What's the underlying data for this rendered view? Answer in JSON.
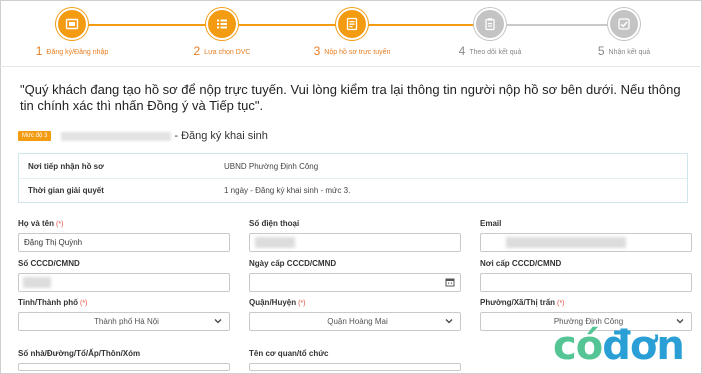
{
  "stepper": {
    "steps": [
      {
        "num": "1",
        "label": "Đăng ký/Đăng nhập",
        "icon": "login-icon",
        "active": true
      },
      {
        "num": "2",
        "label": "Lựa chọn DVC",
        "icon": "list-icon",
        "active": true
      },
      {
        "num": "3",
        "label": "Nộp hồ sơ trực tuyến",
        "icon": "document-icon",
        "active": true
      },
      {
        "num": "4",
        "label": "Theo dõi kết quả",
        "icon": "clipboard-icon",
        "active": false
      },
      {
        "num": "5",
        "label": "Nhận kết quả",
        "icon": "checkbox-icon",
        "active": false
      }
    ]
  },
  "notice": "\"Quý khách đang tạo hồ sơ để nộp trực tuyến. Vui lòng kiểm tra lại thông tin người nộp hồ sơ bên dưới. Nếu thông tin chính xác thì nhấn Đồng ý và Tiếp tục\".",
  "procedure": {
    "level_badge": "Mức độ 3",
    "name": "- Đăng ký khai sinh"
  },
  "info": {
    "receiver_label": "Nơi tiếp nhận hồ sơ",
    "receiver_value": "UBND Phường Định Công",
    "duration_label": "Thời gian giải quyết",
    "duration_value": "1 ngày - Đăng ký khai sinh - mức 3."
  },
  "form": {
    "required_mark": "(*)",
    "full_name": {
      "label": "Họ và tên",
      "value": "Đặng Thị Quỳnh"
    },
    "phone": {
      "label": "Số điện thoại"
    },
    "email": {
      "label": "Email"
    },
    "id_number": {
      "label": "Số CCCD/CMND"
    },
    "id_issue_date": {
      "label": "Ngày cấp CCCD/CMND"
    },
    "id_issue_place": {
      "label": "Nơi cấp CCCD/CMND"
    },
    "province": {
      "label": "Tỉnh/Thành phố",
      "value": "Thành phố Hà Nội"
    },
    "district": {
      "label": "Quận/Huyện",
      "value": "Quận Hoàng Mai"
    },
    "ward": {
      "label": "Phường/Xã/Thị trấn",
      "value": "Phường Định Công"
    },
    "address": {
      "label": "Số nhà/Đường/Tổ/Ấp/Thôn/Xóm"
    },
    "org_name": {
      "label": "Tên cơ quan/tổ chức"
    }
  },
  "watermark": {
    "part1": "có",
    "part2": "đơn"
  },
  "colors": {
    "accent": "#f39c12",
    "inactive": "#c4c4c4",
    "required": "#e74c3c",
    "logo_green": "#56c596",
    "logo_blue": "#2a9fd6"
  }
}
